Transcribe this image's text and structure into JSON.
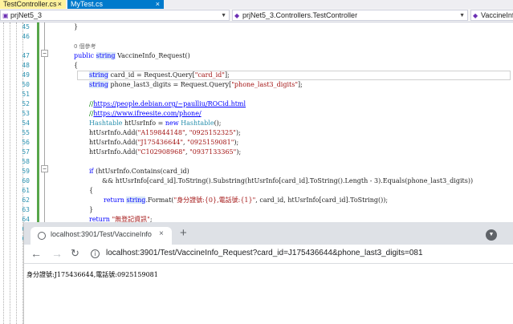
{
  "ide": {
    "tabs": [
      {
        "label": "TestController.cs",
        "close": "×"
      },
      {
        "label": "MyTest.cs",
        "close": "×"
      }
    ],
    "nav": {
      "project": "prjNet5_3",
      "class": "prjNet5_3.Controllers.TestController",
      "member": "VaccineInfo_"
    },
    "lines": [
      {
        "n": "45",
        "indent": 92,
        "tokens": [
          {
            "t": "}",
            "c": ""
          }
        ]
      },
      {
        "n": "46",
        "indent": 92,
        "tokens": []
      },
      {
        "n": "",
        "indent": 92,
        "tokens": [
          {
            "t": "0 個參考",
            "c": "ref"
          }
        ]
      },
      {
        "n": "47",
        "indent": 92,
        "tokens": [
          {
            "t": "public ",
            "c": "kw"
          },
          {
            "t": "string",
            "c": "kw hlw"
          },
          {
            "t": " VaccineInfo_Request()",
            "c": ""
          }
        ]
      },
      {
        "n": "48",
        "indent": 92,
        "tokens": [
          {
            "t": "{",
            "c": ""
          }
        ]
      },
      {
        "n": "49",
        "indent": 111,
        "tokens": [
          {
            "t": "string",
            "c": "kw hlw"
          },
          {
            "t": " card_id = Request.Query[",
            "c": ""
          },
          {
            "t": "\"card_id\"",
            "c": "st"
          },
          {
            "t": "];",
            "c": ""
          }
        ]
      },
      {
        "n": "50",
        "indent": 111,
        "tokens": [
          {
            "t": "string",
            "c": "kw hlw"
          },
          {
            "t": " phone_last3_digits = Request.Query[",
            "c": ""
          },
          {
            "t": "\"phone_last3_digits\"",
            "c": "st"
          },
          {
            "t": "];",
            "c": ""
          }
        ]
      },
      {
        "n": "51",
        "indent": 111,
        "tokens": []
      },
      {
        "n": "52",
        "indent": 111,
        "tokens": [
          {
            "t": "//",
            "c": "cm"
          },
          {
            "t": "https://people.debian.org/~paulliu/ROCid.html",
            "c": "lk"
          }
        ]
      },
      {
        "n": "53",
        "indent": 111,
        "tokens": [
          {
            "t": "//",
            "c": "cm"
          },
          {
            "t": "https://www.ifreesite.com/phone/",
            "c": "lk"
          }
        ]
      },
      {
        "n": "54",
        "indent": 111,
        "tokens": [
          {
            "t": "Hashtable",
            "c": "ty"
          },
          {
            "t": " htUsrInfo = ",
            "c": ""
          },
          {
            "t": "new",
            "c": "kw"
          },
          {
            "t": " ",
            "c": ""
          },
          {
            "t": "Hashtable",
            "c": "ty"
          },
          {
            "t": "();",
            "c": ""
          }
        ]
      },
      {
        "n": "55",
        "indent": 111,
        "tokens": [
          {
            "t": "htUsrInfo.Add(",
            "c": ""
          },
          {
            "t": "\"A159844148\"",
            "c": "st"
          },
          {
            "t": ", ",
            "c": ""
          },
          {
            "t": "\"0925152325\"",
            "c": "st"
          },
          {
            "t": ");",
            "c": ""
          }
        ]
      },
      {
        "n": "56",
        "indent": 111,
        "tokens": [
          {
            "t": "htUsrInfo.Add(",
            "c": ""
          },
          {
            "t": "\"J175436644\"",
            "c": "st"
          },
          {
            "t": ", ",
            "c": ""
          },
          {
            "t": "\"0925159081\"",
            "c": "st"
          },
          {
            "t": ");",
            "c": ""
          }
        ]
      },
      {
        "n": "57",
        "indent": 111,
        "tokens": [
          {
            "t": "htUsrInfo.Add(",
            "c": ""
          },
          {
            "t": "\"C102908968\"",
            "c": "st"
          },
          {
            "t": ", ",
            "c": ""
          },
          {
            "t": "\"0937133365\"",
            "c": "st"
          },
          {
            "t": ");",
            "c": ""
          }
        ]
      },
      {
        "n": "58",
        "indent": 111,
        "tokens": []
      },
      {
        "n": "59",
        "indent": 111,
        "tokens": [
          {
            "t": "if",
            "c": "kw"
          },
          {
            "t": " (htUsrInfo.Contains(card_id)",
            "c": ""
          }
        ]
      },
      {
        "n": "60",
        "indent": 127,
        "tokens": [
          {
            "t": "&& htUsrInfo[card_id].ToString().Substring(htUsrInfo[card_id].ToString().Length - 3).Equals(phone_last3_digits))",
            "c": ""
          }
        ]
      },
      {
        "n": "61",
        "indent": 111,
        "tokens": [
          {
            "t": "{",
            "c": ""
          }
        ]
      },
      {
        "n": "62",
        "indent": 129,
        "tokens": [
          {
            "t": "return",
            "c": "kw"
          },
          {
            "t": " ",
            "c": ""
          },
          {
            "t": "string",
            "c": "kw hlw"
          },
          {
            "t": ".Format(",
            "c": ""
          },
          {
            "t": "\"身分證號:{0},電話號:{1}\"",
            "c": "st"
          },
          {
            "t": ", card_id, htUsrInfo[card_id].ToString());",
            "c": ""
          }
        ]
      },
      {
        "n": "63",
        "indent": 111,
        "tokens": [
          {
            "t": "}",
            "c": ""
          }
        ]
      },
      {
        "n": "64",
        "indent": 111,
        "tokens": [
          {
            "t": "return",
            "c": "kw"
          },
          {
            "t": " ",
            "c": ""
          },
          {
            "t": "\"無登記資訊\"",
            "c": "st"
          },
          {
            "t": ";",
            "c": ""
          }
        ]
      },
      {
        "n": "65",
        "indent": 92,
        "tokens": [
          {
            "t": "}",
            "c": ""
          }
        ]
      },
      {
        "n": "66",
        "indent": 92,
        "tokens": []
      }
    ],
    "colors": {
      "added_marker": "#57a64a",
      "keyword": "#0000ff",
      "type": "#2b91af",
      "string": "#a31515",
      "comment": "#008000"
    }
  },
  "browser": {
    "tab_title": "localhost:3901/Test/VaccineInfo",
    "tab_close": "×",
    "new_tab": "+",
    "back": "←",
    "forward": "→",
    "reload": "C",
    "info_icon": "i",
    "url": "localhost:3901/Test/VaccineInfo_Request?card_id=J175436644&phone_last3_digits=081",
    "result": "身分證號:J175436644,電話號:0925159081"
  }
}
